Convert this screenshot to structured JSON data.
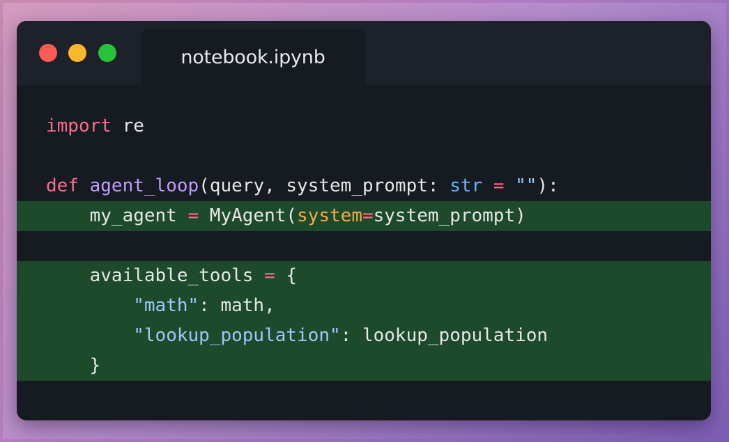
{
  "window": {
    "tab_title": "notebook.ipynb"
  },
  "code": {
    "lines": [
      {
        "tokens": [
          [
            "kw",
            "import"
          ],
          [
            "pl",
            " re"
          ]
        ]
      },
      {
        "tokens": []
      },
      {
        "tokens": [
          [
            "kw",
            "def"
          ],
          [
            "pl",
            " "
          ],
          [
            "fn",
            "agent_loop"
          ],
          [
            "pl",
            "(query, system_prompt: "
          ],
          [
            "ty",
            "str"
          ],
          [
            "pl",
            " "
          ],
          [
            "op",
            "="
          ],
          [
            "pl",
            " "
          ],
          [
            "st",
            "\"\""
          ],
          [
            "pl",
            "):"
          ]
        ]
      },
      {
        "highlight": true,
        "tokens": [
          [
            "pl",
            "    my_agent "
          ],
          [
            "op",
            "="
          ],
          [
            "pl",
            " MyAgent("
          ],
          [
            "ar",
            "system"
          ],
          [
            "op",
            "="
          ],
          [
            "pl",
            "system_prompt)"
          ]
        ]
      },
      {
        "tokens": []
      },
      {
        "highlight": true,
        "tokens": [
          [
            "pl",
            "    available_tools "
          ],
          [
            "op",
            "="
          ],
          [
            "pl",
            " {"
          ]
        ]
      },
      {
        "highlight": true,
        "tokens": [
          [
            "pl",
            "        "
          ],
          [
            "st",
            "\"math\""
          ],
          [
            "pl",
            ": math,"
          ]
        ]
      },
      {
        "highlight": true,
        "tokens": [
          [
            "pl",
            "        "
          ],
          [
            "st",
            "\"lookup_population\""
          ],
          [
            "pl",
            ": lookup_population"
          ]
        ]
      },
      {
        "highlight": true,
        "tokens": [
          [
            "pl",
            "    }"
          ]
        ]
      }
    ]
  },
  "colors": {
    "keyword": "#ff6b8a",
    "function": "#c39bff",
    "type": "#67b4ff",
    "string": "#9cc7ff",
    "argument": "#f3a94a",
    "highlight_bg": "#1d4a2a"
  }
}
